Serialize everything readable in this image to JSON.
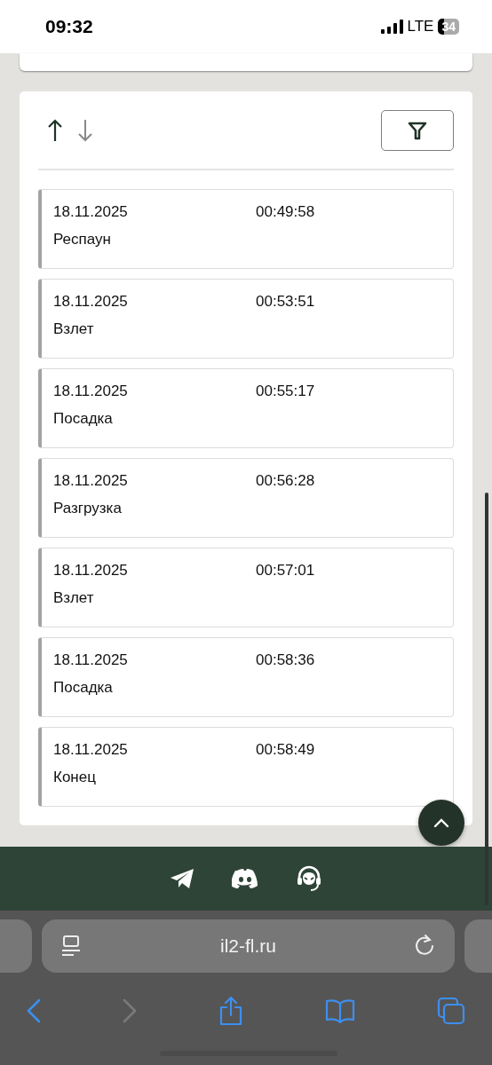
{
  "status_bar": {
    "time": "09:32",
    "network": "LTE",
    "battery": "34"
  },
  "sort_buttons": [
    {
      "kind": "up",
      "selected": true
    },
    {
      "kind": "down",
      "selected": false
    }
  ],
  "events": [
    {
      "date": "18.11.2025",
      "time": "00:49:58",
      "name": "Респаун"
    },
    {
      "date": "18.11.2025",
      "time": "00:53:51",
      "name": "Взлет"
    },
    {
      "date": "18.11.2025",
      "time": "00:55:17",
      "name": "Посадка"
    },
    {
      "date": "18.11.2025",
      "time": "00:56:28",
      "name": "Разгрузка"
    },
    {
      "date": "18.11.2025",
      "time": "00:57:01",
      "name": "Взлет"
    },
    {
      "date": "18.11.2025",
      "time": "00:58:36",
      "name": "Посадка"
    },
    {
      "date": "18.11.2025",
      "time": "00:58:49",
      "name": "Конец"
    }
  ],
  "browser": {
    "url": "il2-fl.ru",
    "toolbar": [
      {
        "kind": "back",
        "disabled": false
      },
      {
        "kind": "forward",
        "disabled": true
      },
      {
        "kind": "share",
        "disabled": false
      },
      {
        "kind": "bookmarks",
        "disabled": false
      },
      {
        "kind": "tabs",
        "disabled": false
      }
    ]
  }
}
